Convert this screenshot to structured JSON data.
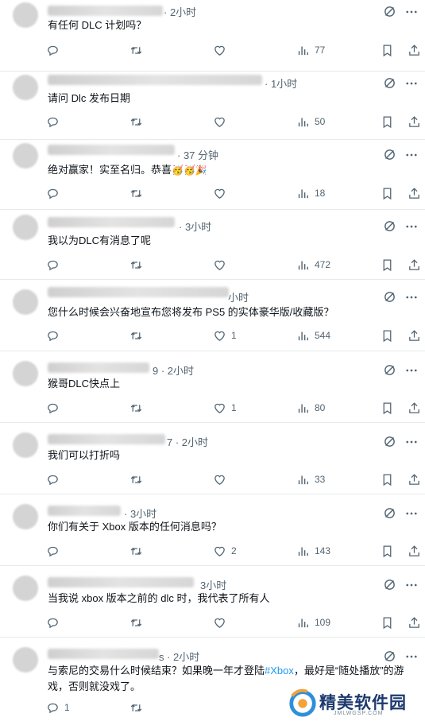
{
  "replies": [
    {
      "time": "· 2小时",
      "text": "有任何 DLC 计划吗？",
      "replies": "",
      "retweets": "",
      "likes": "",
      "views": "77"
    },
    {
      "time": "· 1小时",
      "text": "请问 Dlc 发布日期",
      "replies": "",
      "retweets": "",
      "likes": "",
      "views": "50"
    },
    {
      "time": "· 37 分钟",
      "text": "绝对赢家！实至名归。恭喜",
      "replies": "",
      "retweets": "",
      "likes": "",
      "views": "18"
    },
    {
      "time": "· 3小时",
      "text": "我以为DLC有消息了呢",
      "replies": "",
      "retweets": "",
      "likes": "",
      "views": "472"
    },
    {
      "time": "小时",
      "text": "您什么时候会兴奋地宣布您将发布 PS5 的实体豪华版/收藏版？",
      "replies": "",
      "retweets": "",
      "likes": "1",
      "views": "544"
    },
    {
      "time": "9 · 2小时",
      "text": "猴哥DLC快点上",
      "replies": "",
      "retweets": "",
      "likes": "1",
      "views": "80"
    },
    {
      "time": "7 · 2小时",
      "text": "我们可以打折吗",
      "replies": "",
      "retweets": "",
      "likes": "",
      "views": "33"
    },
    {
      "time": "· 3小时",
      "text": "你们有关于 Xbox 版本的任何消息吗？",
      "replies": "",
      "retweets": "",
      "likes": "2",
      "views": "143"
    },
    {
      "time": "3小时",
      "text": "当我说 xbox 版本之前的 dlc 时，我代表了所有人",
      "replies": "",
      "retweets": "",
      "likes": "",
      "views": "109"
    },
    {
      "time": "s · 2小时",
      "text_before": "与索尼的交易什么时候结束？如果晚一年才登陆",
      "hashtag": "#Xbox",
      "text_after": "，最好是“随处播放”的游戏，否则就没戏了。",
      "replies": "1",
      "retweets": "",
      "likes": "",
      "views": ""
    }
  ],
  "watermark": {
    "title": "精美软件园",
    "subtitle": "JMLWGSP.COM"
  },
  "colors": {
    "text": "#0f1419",
    "muted": "#536471",
    "link": "#1d9bf0",
    "divider": "#e7e9ea"
  }
}
